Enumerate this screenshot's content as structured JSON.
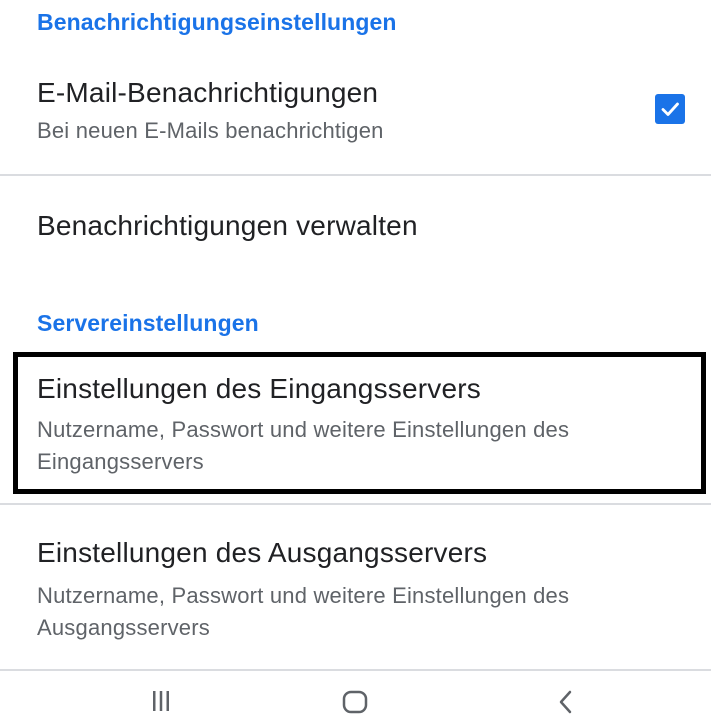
{
  "notifications_section": {
    "header": "Benachrichtigungseinstellungen",
    "email_notifications": {
      "title": "E-Mail-Benachrichtigungen",
      "subtitle": "Bei neuen E-Mails benachrichtigen",
      "checked": true
    },
    "manage_notifications": {
      "title": "Benachrichtigungen verwalten"
    }
  },
  "server_section": {
    "header": "Servereinstellungen",
    "incoming": {
      "title": "Einstellungen des Eingangsservers",
      "subtitle_line1": "Nutzername, Passwort und weitere Einstellungen des",
      "subtitle_line2": "Eingangsservers"
    },
    "outgoing": {
      "title": "Einstellungen des Ausgangsservers",
      "subtitle_line1": "Nutzername, Passwort und weitere Einstellungen des",
      "subtitle_line2": "Ausgangsservers"
    }
  },
  "nav_bar": {
    "buttons": [
      "recent-apps",
      "home",
      "back"
    ]
  },
  "colors": {
    "accent": "#1a73e8",
    "primary_text": "#202124",
    "secondary_text": "#5f6368",
    "divider": "#dadce0",
    "highlight": "#000000"
  }
}
